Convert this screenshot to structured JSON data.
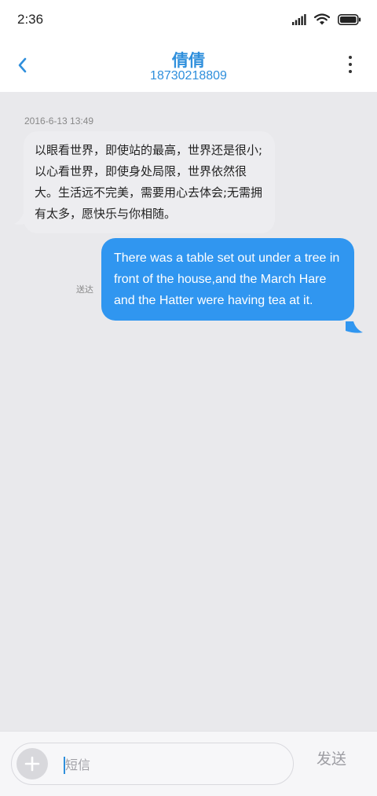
{
  "status_bar": {
    "time": "2:36",
    "icons": [
      "signal-icon",
      "wifi-icon",
      "battery-icon"
    ]
  },
  "header": {
    "contact_name": "倩倩",
    "contact_number": "18730218809",
    "accent_color": "#2f8fdc"
  },
  "messages": {
    "timestamp": "2016-6-13 13:49",
    "incoming": {
      "text": "以眼看世界，即使站的最高，世界还是很小;以心看世界，即使身处局限，世界依然很大。生活远不完美，需要用心去体会;无需拥有太多，愿快乐与你相随。",
      "bubble_color": "#ededf0"
    },
    "outgoing": {
      "text": "There was a table set out under a tree in front of the house,and the March Hare and the Hatter were having tea at it.",
      "status": "送达",
      "bubble_color": "#3096f0"
    }
  },
  "composer": {
    "placeholder": "短信",
    "send_label": "发送"
  }
}
